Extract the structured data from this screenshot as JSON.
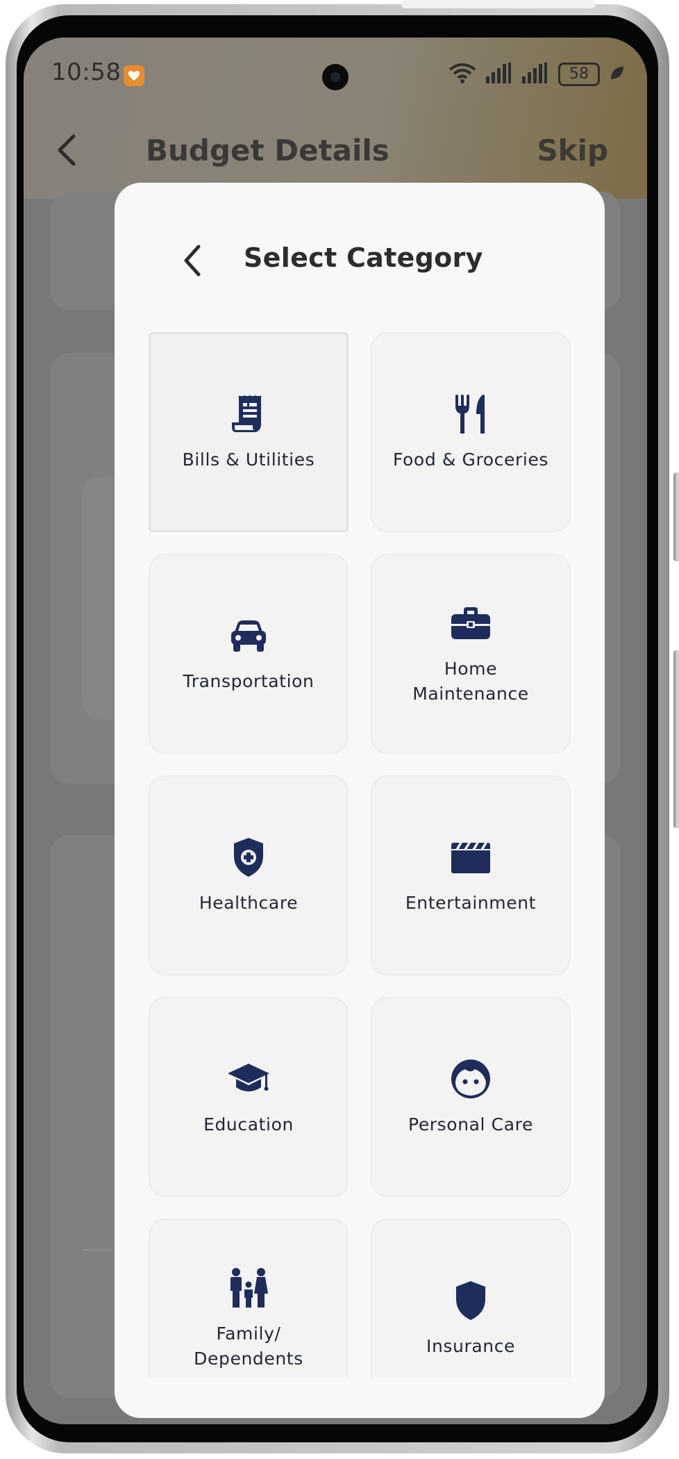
{
  "status_bar": {
    "time": "10:58",
    "battery_level": "58"
  },
  "background_screen": {
    "title": "Budget Details",
    "skip_label": "Skip"
  },
  "modal": {
    "title": "Select Category",
    "selected_index": 0,
    "categories": [
      {
        "label": "Bills & Utilities",
        "icon": "receipt-icon"
      },
      {
        "label": "Food & Groceries",
        "icon": "fork-knife-icon"
      },
      {
        "label": "Transportation",
        "icon": "car-icon"
      },
      {
        "label": "Home Maintenance",
        "icon": "toolbox-icon"
      },
      {
        "label": "Healthcare",
        "icon": "shield-plus-icon"
      },
      {
        "label": "Entertainment",
        "icon": "clapperboard-icon"
      },
      {
        "label": "Education",
        "icon": "graduation-cap-icon"
      },
      {
        "label": "Personal Care",
        "icon": "face-icon"
      },
      {
        "label": "Family/ Dependents",
        "icon": "family-icon"
      },
      {
        "label": "Insurance",
        "icon": "shield-icon"
      }
    ]
  },
  "colors": {
    "icon_navy": "#1f2d5c",
    "modal_background": "#f8f8f8",
    "tile_background": "#f3f3f3",
    "dim_overlay": "#757575",
    "status_app_orange": "#e98b2f"
  }
}
